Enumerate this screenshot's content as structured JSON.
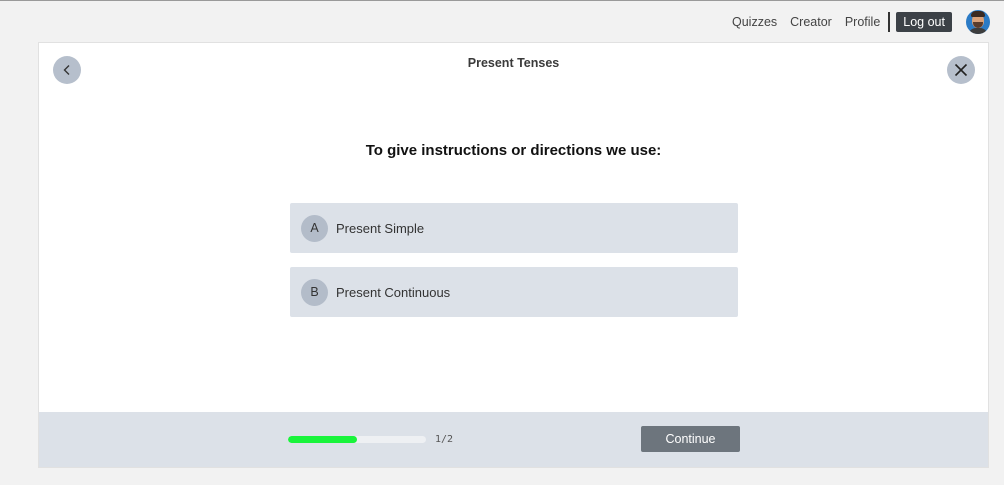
{
  "nav": {
    "links": [
      "Quizzes",
      "Creator",
      "Profile"
    ],
    "logout_label": "Log out",
    "avatar_icon": "user-avatar"
  },
  "quiz": {
    "title": "Present Tenses",
    "back_icon": "chevron-left-icon",
    "close_icon": "close-icon",
    "question": "To give instructions or directions we use:",
    "options": [
      {
        "letter": "A",
        "text": "Present Simple"
      },
      {
        "letter": "B",
        "text": "Present Continuous"
      }
    ]
  },
  "footer": {
    "progress_fraction": 0.5,
    "progress_label": "1/2",
    "continue_label": "Continue"
  },
  "colors": {
    "progress": "#19f43b",
    "continue_button": "#6d757d",
    "logout_button": "#3c4147"
  }
}
